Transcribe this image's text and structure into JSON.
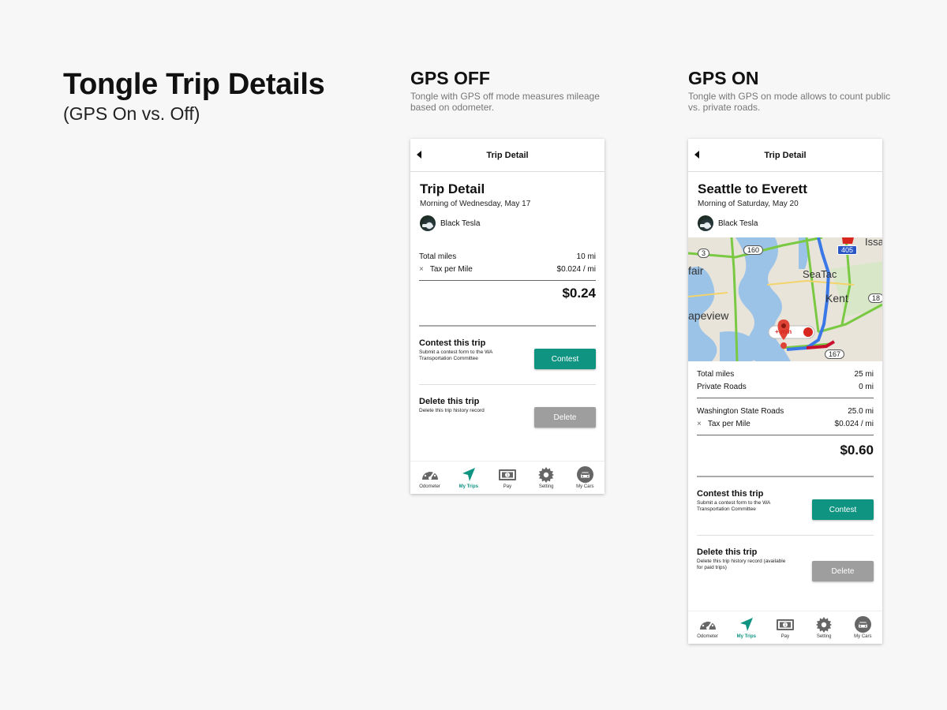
{
  "page": {
    "title": "Tongle Trip Details",
    "subtitle": "(GPS On vs. Off)"
  },
  "gps_off": {
    "heading": "GPS OFF",
    "description": "Tongle with GPS off mode measures mileage based on odometer.",
    "topbar_title": "Trip Detail",
    "trip_title": "Trip Detail",
    "trip_date": "Morning of Wednesday, May 17",
    "car": "Black Tesla",
    "rows": [
      {
        "label": "Total miles",
        "value": "10 mi"
      }
    ],
    "tax": {
      "x": "×",
      "label": "Tax per Mile",
      "value": "$0.024  / mi"
    },
    "total": "$0.24",
    "contest": {
      "title": "Contest this trip",
      "desc": "Submit a contest form to the WA Transportation Committee",
      "button": "Contest"
    },
    "delete": {
      "title": "Delete this trip",
      "desc": "Delete this trip history record",
      "button": "Delete"
    }
  },
  "gps_on": {
    "heading": "GPS ON",
    "description": "Tongle with GPS on mode allows to count public vs. private roads.",
    "topbar_title": "Trip Detail",
    "trip_title": "Seattle to Everett",
    "trip_date": "Morning of Saturday, May 20",
    "car": "Black Tesla",
    "rows": [
      {
        "label": "Total miles",
        "value": "25 mi"
      },
      {
        "label": "Private Roads",
        "value": "0 mi"
      },
      {
        "label": "Washington State Roads",
        "value": "25.0 mi"
      }
    ],
    "tax": {
      "x": "×",
      "label": "Tax per Mile",
      "value": "$0.024  / mi"
    },
    "total": "$0.60",
    "map": {
      "labels": [
        "fair",
        "SeaTac",
        "Kent",
        "apeview",
        "Issa"
      ],
      "shields": [
        "3",
        "160",
        "405",
        "18",
        "167"
      ],
      "route_badge": "+ min"
    },
    "contest": {
      "title": "Contest this trip",
      "desc": "Submit a contest form to the WA Transportation Committee",
      "button": "Contest"
    },
    "delete": {
      "title": "Delete this trip",
      "desc": "Delete this trip history record (available for paid trips)",
      "button": "Delete"
    }
  },
  "nav": [
    {
      "label": "Odometer",
      "icon": "odometer-icon"
    },
    {
      "label": "My Trips",
      "icon": "navigation-arrow-icon"
    },
    {
      "label": "Pay",
      "icon": "money-icon"
    },
    {
      "label": "Setting",
      "icon": "gear-icon"
    },
    {
      "label": "My Cars",
      "icon": "car-icon"
    }
  ],
  "colors": {
    "accent": "#0f9482",
    "disabled": "#9e9e9e"
  }
}
